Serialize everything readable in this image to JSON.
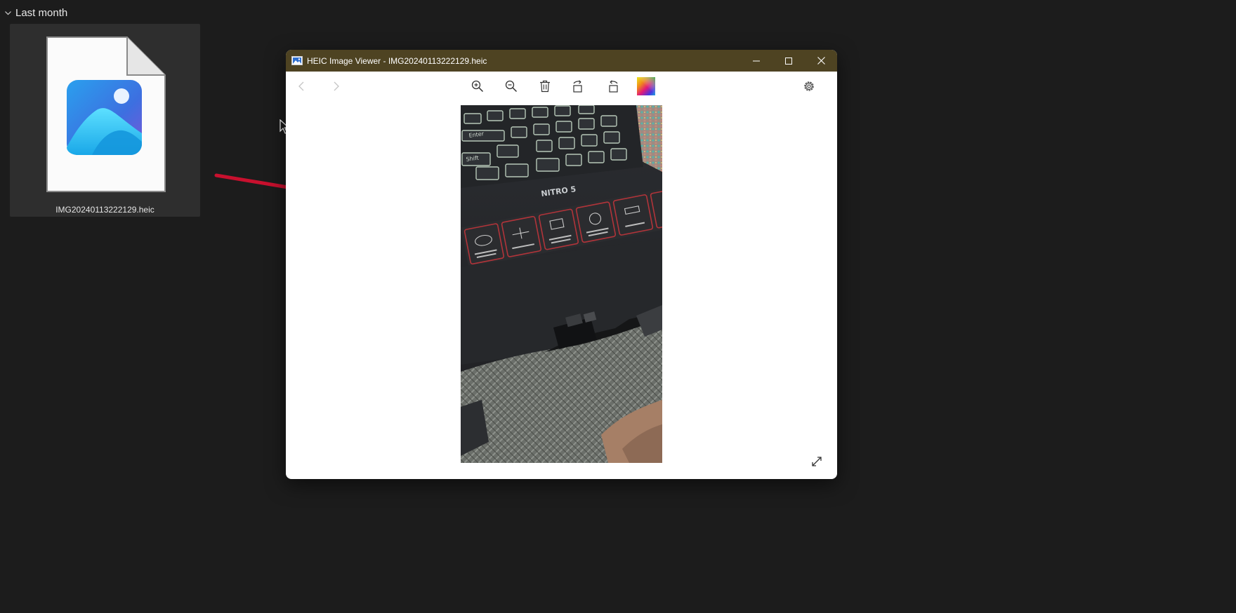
{
  "explorer": {
    "group_label": "Last month",
    "file": {
      "name": "IMG20240113222129.heic"
    }
  },
  "viewer": {
    "title": "HEIC Image Viewer - IMG20240113222129.heic",
    "window_controls": [
      "minimize-icon",
      "maximize-icon",
      "close-icon"
    ],
    "toolbar": [
      "previous-icon",
      "next-icon",
      "zoom-in-icon",
      "zoom-out-icon",
      "delete-icon",
      "rotate-left-icon",
      "rotate-right-icon",
      "color-palette-icon",
      "settings-icon"
    ],
    "photo": {
      "keyboard_labels": [
        "Enter",
        "Shift",
        "NITRO 5"
      ]
    },
    "fullscreen_icon": "expand-icon"
  },
  "colors": {
    "desktop_bg": "#1c1c1c",
    "tile_bg": "#2e2e2e",
    "titlebar_bg": "#4e4322",
    "annotation_arrow": "#c8102e"
  }
}
